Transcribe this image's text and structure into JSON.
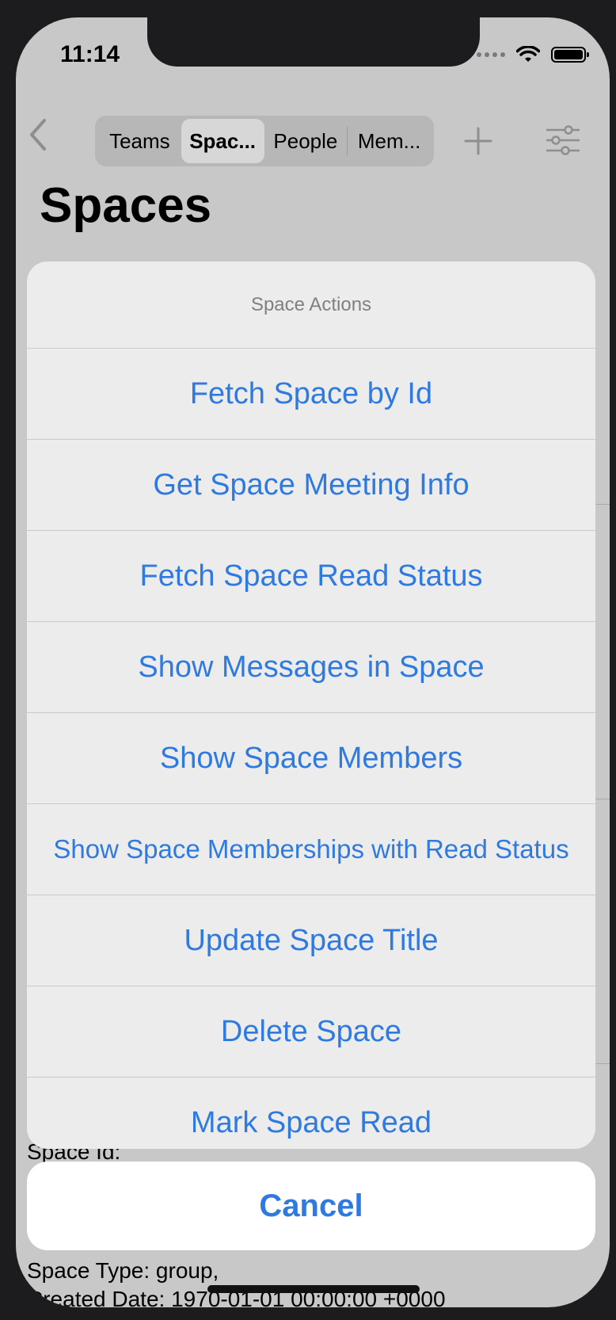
{
  "status_bar": {
    "time": "11:14"
  },
  "nav": {
    "segments": [
      "Teams",
      "Spac...",
      "People",
      "Mem..."
    ],
    "selected_index": 1
  },
  "page": {
    "title": "Spaces"
  },
  "background_rows": {
    "space_id_label": "Space Id:",
    "space_type": "Space Type: group,",
    "created_date": "Created Date: 1970-01-01 00:00:00 +0000"
  },
  "sheet": {
    "title": "Space Actions",
    "actions": [
      "Fetch Space by Id",
      "Get Space Meeting Info",
      "Fetch Space Read Status",
      "Show Messages in Space",
      "Show Space Members",
      "Show Space Memberships with Read Status",
      "Update Space Title",
      "Delete Space",
      "Mark Space Read"
    ],
    "cancel_label": "Cancel"
  },
  "colors": {
    "accent": "#2f7ae0",
    "dim_background": "#c8c8c8",
    "sheet": "#ececec"
  }
}
